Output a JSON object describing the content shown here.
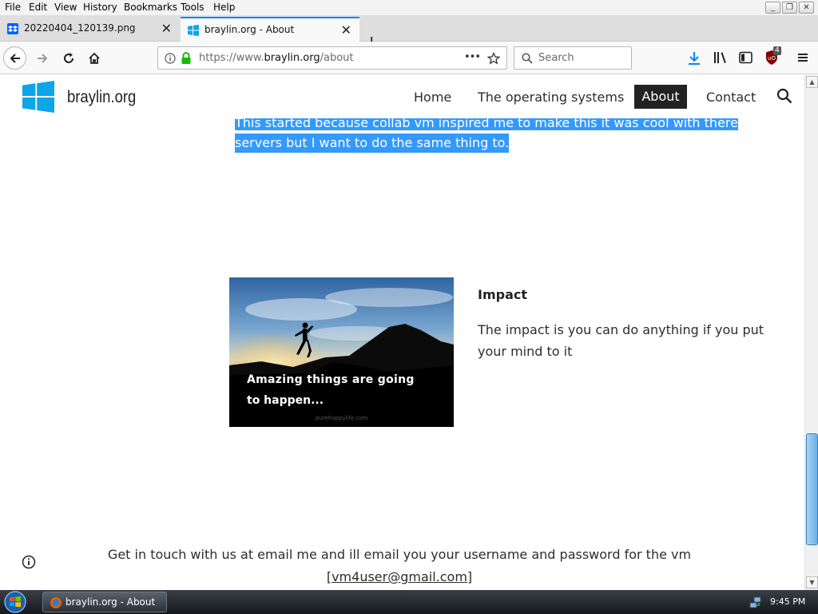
{
  "window": {
    "menu": [
      "File",
      "Edit",
      "View",
      "History",
      "Bookmarks",
      "Tools",
      "Help"
    ],
    "controls": {
      "minimize": "_",
      "restore": "❐",
      "close": "✕"
    }
  },
  "tabs": [
    {
      "title": "20220404_120139.png",
      "active": false,
      "icon": "dropbox-icon"
    },
    {
      "title": "braylin.org - About",
      "active": true,
      "icon": "windows-logo-icon"
    }
  ],
  "navbar": {
    "url_prefix": "https://www.",
    "url_domain": "braylin.org",
    "url_suffix": "/about",
    "page_actions": "•••",
    "search_placeholder": "Search",
    "ublock_badge": "4"
  },
  "site": {
    "name": "braylin.org",
    "nav": [
      "Home",
      "The operating systems",
      "About",
      "Contact"
    ],
    "active_nav": "About"
  },
  "content": {
    "selected_line1": "This started because collab vm inspired me to make this it was cool with there",
    "selected_line2": "servers but I want to do the same thing to.",
    "image_caption_line1": "Amazing things are going",
    "image_caption_line2": "to happen...",
    "image_watermark": "purehappylife.com",
    "impact_heading": "Impact",
    "impact_text": "The impact is you can do anything if you put your mind to it"
  },
  "footer": {
    "text": "Get in touch with us at email me and ill email you your username and password for the vm",
    "bracket_open": "[",
    "email": "vm4user@gmail.com",
    "bracket_close": "]"
  },
  "taskbar": {
    "task_title": "braylin.org - About ...",
    "clock": "9:45 PM"
  },
  "colors": {
    "selection": "#3399ff",
    "active_nav_bg": "#222222",
    "windows_blue": "#0ea5e9",
    "firefox_accent": "#0a84ff"
  }
}
